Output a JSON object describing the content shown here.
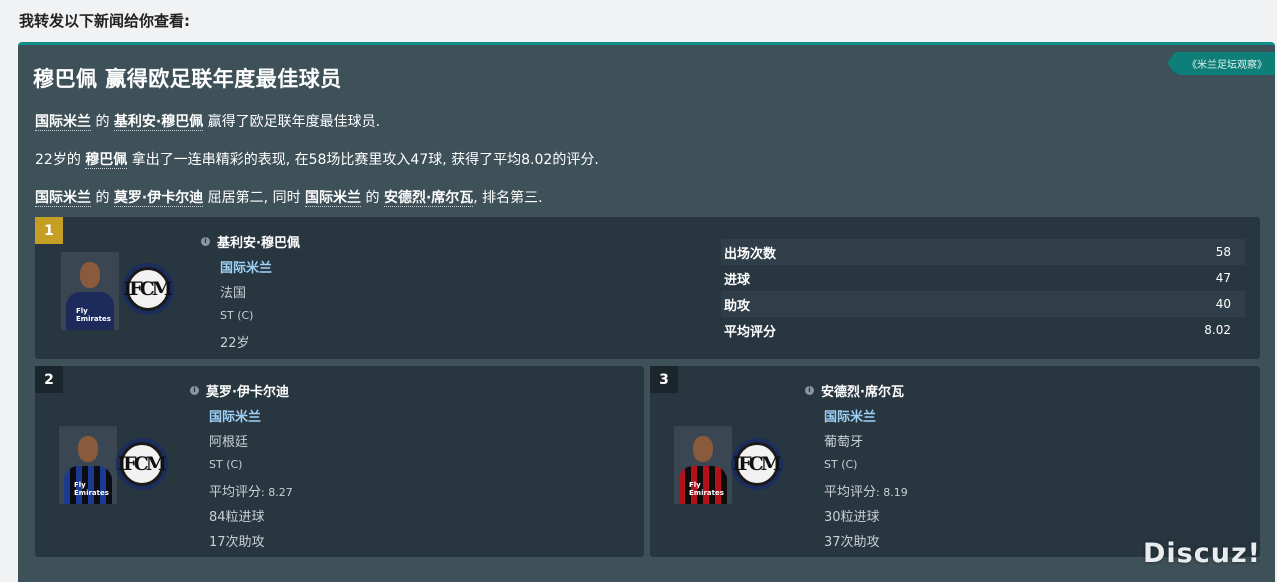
{
  "intro_text": "我转发以下新闻给你查看:",
  "source_tag": "《米兰足坛观察》",
  "headline": "穆巴佩 赢得欧足联年度最佳球员",
  "paragraph1": {
    "club": "国际米兰",
    "t1": " 的 ",
    "player": "基利安·穆巴佩",
    "t2": " 赢得了欧足联年度最佳球员."
  },
  "paragraph2": {
    "t1": "22岁的 ",
    "player": "穆巴佩",
    "t2": " 拿出了一连串精彩的表现, 在58场比赛里攻入47球, 获得了平均8.02的评分."
  },
  "paragraph3": {
    "club1": "国际米兰",
    "t1": " 的 ",
    "player1": "莫罗·伊卡尔迪",
    "t2": " 屈居第二, 同时 ",
    "club2": "国际米兰",
    "t3": " 的 ",
    "player2": "安德烈·席尔瓦",
    "t4": ", 排名第三."
  },
  "first": {
    "rank": "1",
    "name": "基利安·穆巴佩",
    "club": "国际米兰",
    "nation": "法国",
    "position": "ST (C)",
    "age": "22岁",
    "stats": [
      {
        "label": "出场次数",
        "value": "58"
      },
      {
        "label": "进球",
        "value": "47"
      },
      {
        "label": "助攻",
        "value": "40"
      },
      {
        "label": "平均评分",
        "value": "8.02"
      }
    ]
  },
  "second": {
    "rank": "2",
    "name": "莫罗·伊卡尔迪",
    "club": "国际米兰",
    "nation": "阿根廷",
    "position": "ST (C)",
    "rating_label": "平均评分",
    "rating_value": ": 8.27",
    "goals": "84粒进球",
    "assists": "17次助攻"
  },
  "third": {
    "rank": "3",
    "name": "安德烈·席尔瓦",
    "club": "国际米兰",
    "nation": "葡萄牙",
    "position": "ST (C)",
    "rating_label": "平均评分",
    "rating_value": ": 8.19",
    "goals": "30粒进球",
    "assists": "37次助攻"
  },
  "photo_sponsor": "Fly Emirates",
  "badge_monogram": "IFCM",
  "watermark": "Discuz!",
  "colors": {
    "panel": "#3e5058",
    "card": "#283640",
    "accent_teal": "#0d8f86",
    "rank_gold": "#c49f24",
    "club_link": "#9fd0f5"
  }
}
